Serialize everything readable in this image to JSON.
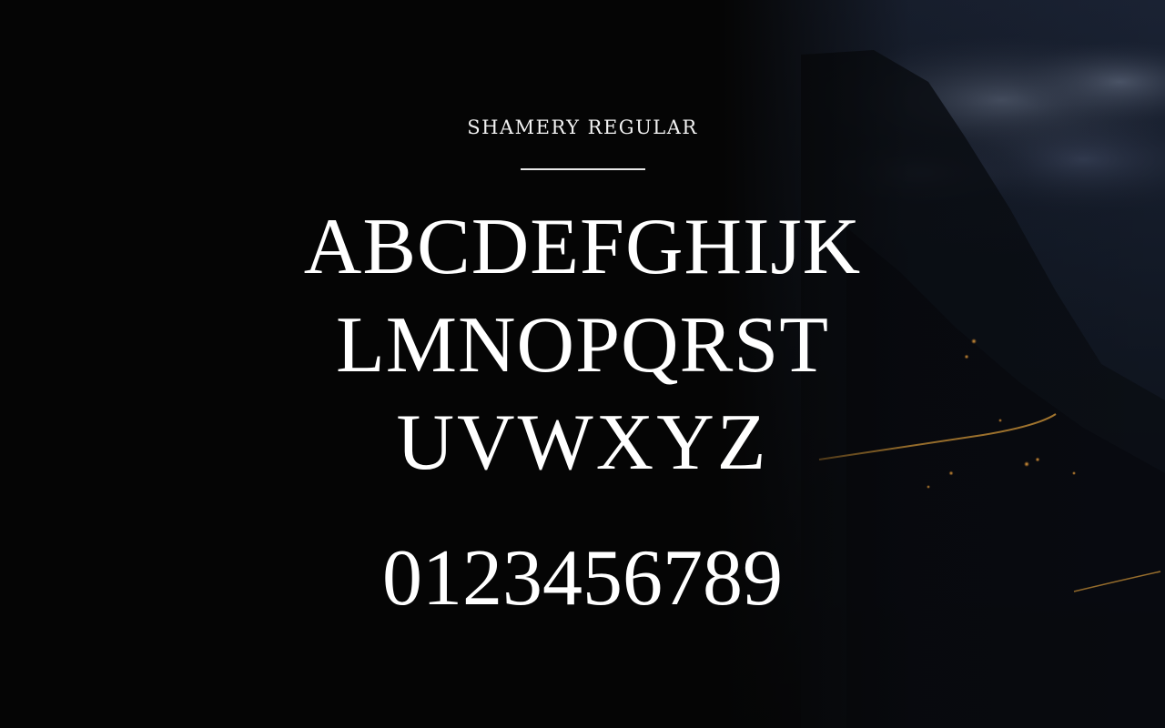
{
  "font_specimen": {
    "title": "SHAMERY REGULAR",
    "uppercase_rows": [
      "ABCDEFGHIJK",
      "LMNOPQRST",
      "UVWXYZ"
    ],
    "digits": "0123456789"
  },
  "colors": {
    "background": "#050505",
    "text": "#ffffff"
  },
  "background_image": "night-mountain-valley-with-clouds-and-lights"
}
